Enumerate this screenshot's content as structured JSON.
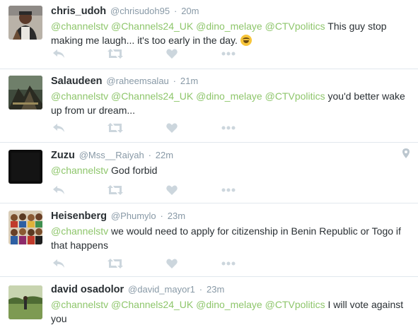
{
  "tweets": [
    {
      "fullname": "chris_udoh",
      "handle": "@chrisudoh95",
      "sep": "·",
      "time": "20m",
      "mentions": [
        "@channelstv",
        "@Channels24_UK",
        "@dino_melaye",
        "@CTVpolitics"
      ],
      "text": "This guy stop making  me laugh...  it's too early in the day.",
      "emoji": "face-with-tears-of-joy-emoji"
    },
    {
      "fullname": "Salaudeen",
      "handle": "@raheemsalau",
      "sep": "·",
      "time": "21m",
      "mentions": [
        "@channelstv",
        "@Channels24_UK",
        "@dino_melaye",
        "@CTVpolitics"
      ],
      "text": "you'd better wake up from ur dream..."
    },
    {
      "fullname": "Zuzu",
      "handle": "@Mss__Raiyah",
      "sep": "·",
      "time": "22m",
      "mentions": [
        "@channelstv"
      ],
      "text": "God forbid",
      "geo_icon": "location-pin-icon"
    },
    {
      "fullname": "Heisenberg",
      "handle": "@Phumylo",
      "sep": "·",
      "time": "23m",
      "mentions": [
        "@channelstv"
      ],
      "text": "we would need to apply for citizenship in Benin Republic or Togo if that happens"
    },
    {
      "fullname": "david osadolor",
      "handle": "@david_mayor1",
      "sep": "·",
      "time": "23m",
      "mentions": [
        "@channelstv",
        "@Channels24_UK",
        "@dino_melaye",
        "@CTVpolitics"
      ],
      "text": "I will vote against you"
    }
  ],
  "action_icons": [
    "reply-icon",
    "retweet-icon",
    "like-icon",
    "more-icon"
  ],
  "colors": {
    "mention": "#8ec66b",
    "muted": "#8899a6",
    "action_icon": "#ccd6dd",
    "divider": "#e1e8ed"
  }
}
